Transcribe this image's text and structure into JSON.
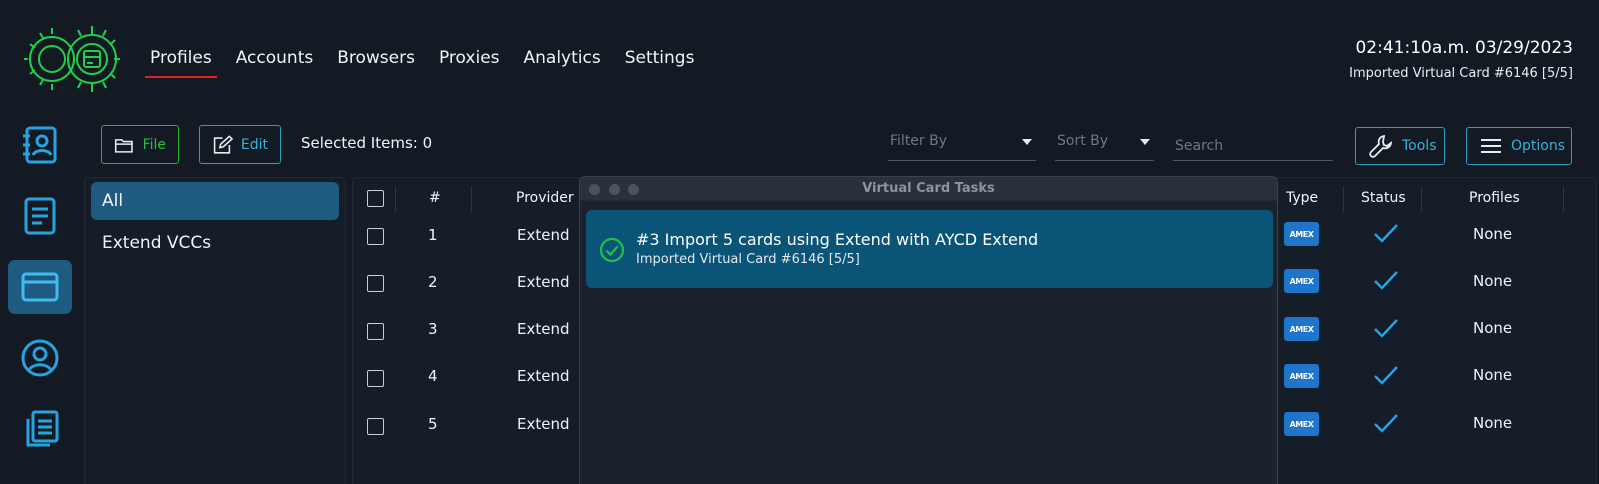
{
  "header": {
    "nav": [
      {
        "label": "Profiles",
        "active": true
      },
      {
        "label": "Accounts",
        "active": false
      },
      {
        "label": "Browsers",
        "active": false
      },
      {
        "label": "Proxies",
        "active": false
      },
      {
        "label": "Analytics",
        "active": false
      },
      {
        "label": "Settings",
        "active": false
      }
    ],
    "clock": "02:41:10a.m. 03/29/2023",
    "status": "Imported Virtual Card #6146 [5/5]"
  },
  "sidebar": {
    "icons": [
      "contacts-book-icon",
      "document-icon",
      "credit-card-icon",
      "user-circle-icon",
      "copy-documents-icon"
    ],
    "active_index": 2
  },
  "toolbar": {
    "file_label": "File",
    "edit_label": "Edit",
    "selected_items": "Selected Items: 0",
    "filter_placeholder": "Filter By",
    "sort_placeholder": "Sort By",
    "search_placeholder": "Search",
    "tools_label": "Tools",
    "options_label": "Options"
  },
  "groups": [
    {
      "label": "All",
      "active": true
    },
    {
      "label": "Extend VCCs",
      "active": false
    }
  ],
  "table": {
    "headers": {
      "num": "#",
      "provider": "Provider",
      "type": "Type",
      "status": "Status",
      "profiles": "Profiles"
    },
    "rows": [
      {
        "num": "1",
        "provider": "Extend",
        "type": "AMEX",
        "profiles": "None"
      },
      {
        "num": "2",
        "provider": "Extend",
        "type": "AMEX",
        "profiles": "None"
      },
      {
        "num": "3",
        "provider": "Extend",
        "type": "AMEX",
        "profiles": "None"
      },
      {
        "num": "4",
        "provider": "Extend",
        "type": "AMEX",
        "profiles": "None"
      },
      {
        "num": "5",
        "provider": "Extend",
        "type": "AMEX",
        "profiles": "None"
      }
    ]
  },
  "modal": {
    "title": "Virtual Card Tasks",
    "task": {
      "title": "#3 Import 5 cards using Extend with AYCD Extend",
      "subtitle": "Imported Virtual Card #6146 [5/5]"
    }
  },
  "colors": {
    "background": "#131a24",
    "accent_blue": "#39b0d6",
    "accent_green": "#22c145",
    "active_underline": "#e0231f",
    "selected_fill": "#1f5b80",
    "task_card": "#0a5478"
  }
}
